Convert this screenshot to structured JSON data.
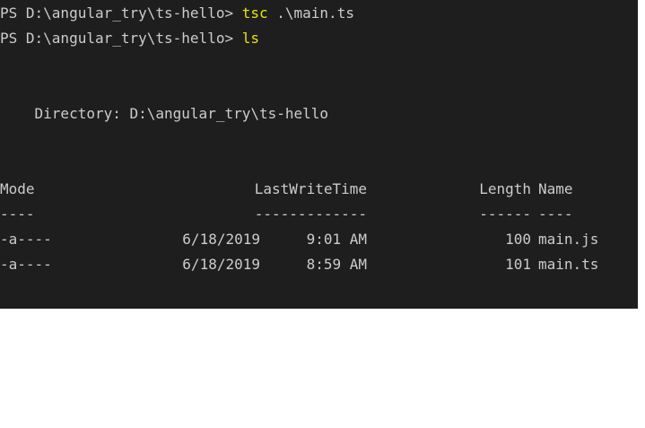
{
  "terminal": {
    "colors": {
      "background": "#1e1e1e",
      "text": "#cccccc",
      "command": "#e5e510"
    },
    "lines": [
      {
        "prompt": "PS D:\\angular_try\\ts-hello> ",
        "command": "tsc",
        "args": " .\\main.ts"
      },
      {
        "prompt": "PS D:\\angular_try\\ts-hello> ",
        "command": "ls",
        "args": ""
      }
    ],
    "directory_line": "    Directory: D:\\angular_try\\ts-hello",
    "table": {
      "headers": {
        "mode": "Mode",
        "last_write_time": "LastWriteTime",
        "length": "Length",
        "name": "Name"
      },
      "separators": {
        "mode": "----",
        "last_write_time": "-------------",
        "length": "------",
        "name": "----"
      },
      "rows": [
        {
          "mode": "-a----",
          "date": "6/18/2019",
          "time": "9:01 AM",
          "length": "100",
          "name": "main.js"
        },
        {
          "mode": "-a----",
          "date": "6/18/2019",
          "time": "8:59 AM",
          "length": "101",
          "name": "main.ts"
        }
      ]
    }
  }
}
